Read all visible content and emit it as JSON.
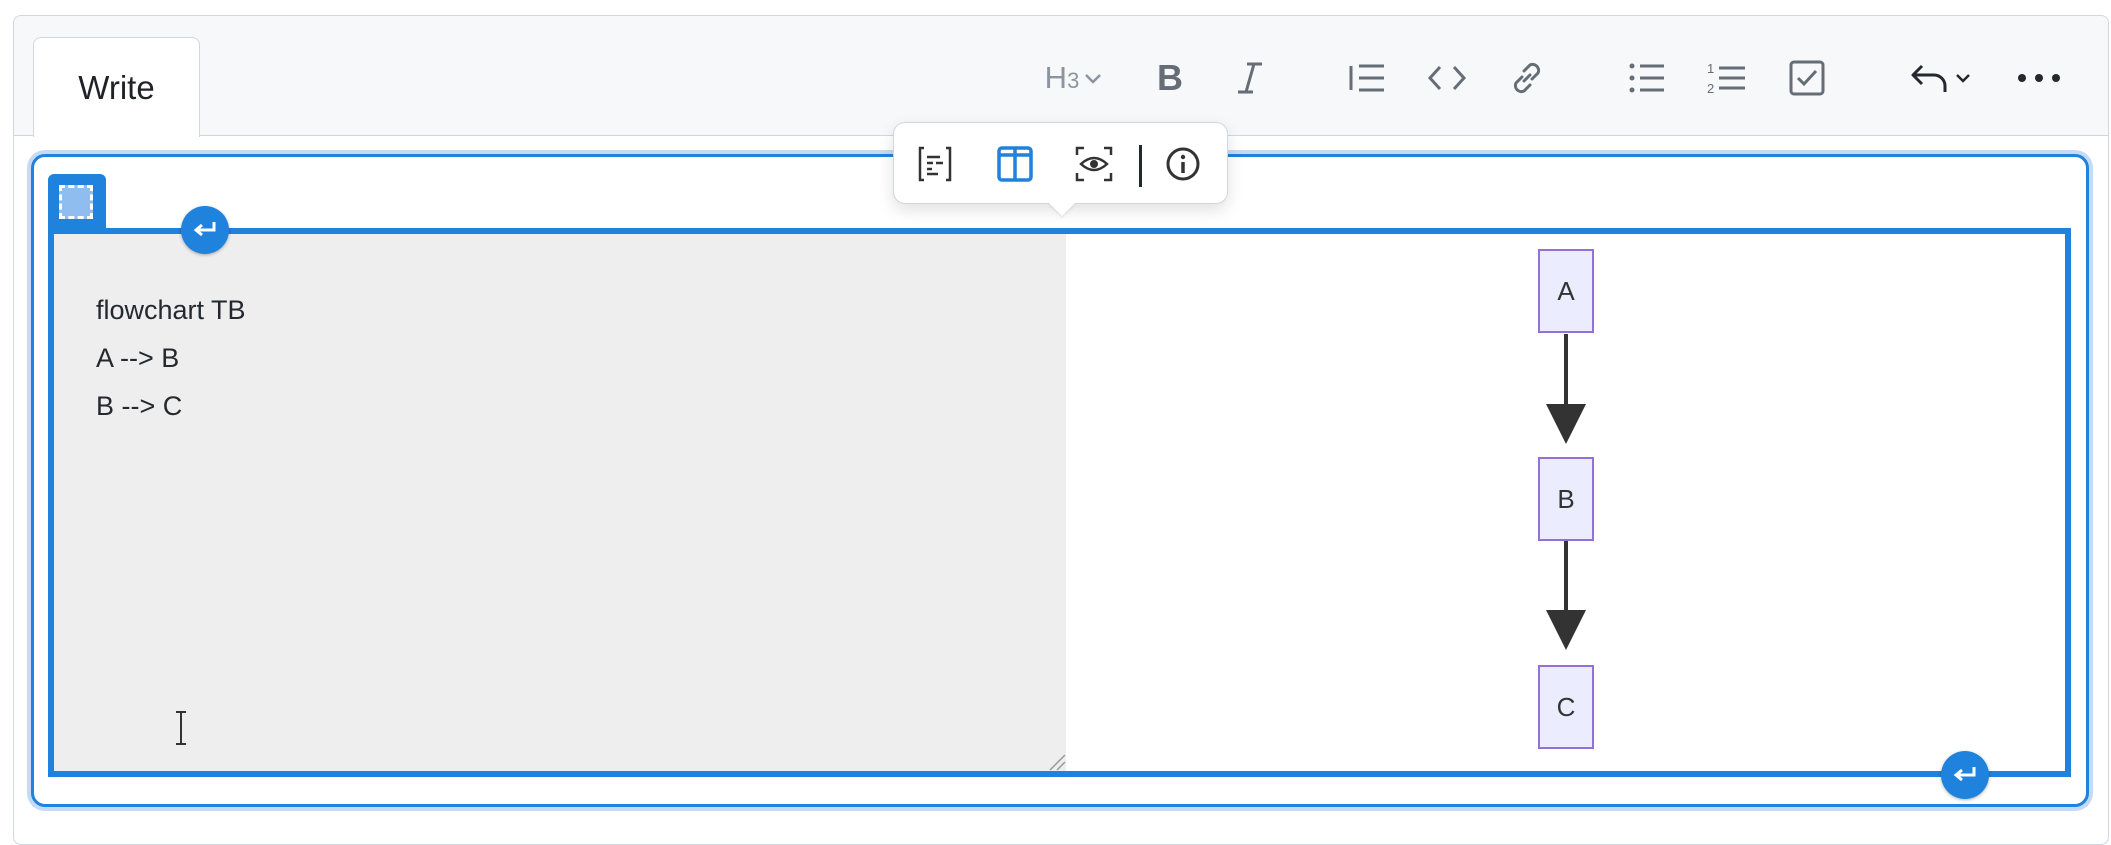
{
  "tabs": {
    "write_label": "Write"
  },
  "toolbar": {
    "heading_label": "H3",
    "buttons": [
      "heading-icon",
      "bold-icon",
      "italic-icon",
      "quote-icon",
      "code-icon",
      "link-icon",
      "bullet-list-icon",
      "numbered-list-icon",
      "task-list-icon",
      "undo-icon",
      "more-icon"
    ]
  },
  "popover": {
    "buttons": [
      "code-only-view-icon",
      "split-view-icon",
      "preview-only-view-icon",
      "info-icon"
    ],
    "active": "split-view-icon"
  },
  "mermaid": {
    "code_lines": [
      "flowchart TB",
      "A --> B",
      "B --> C"
    ],
    "nodes": [
      {
        "id": "A",
        "label": "A"
      },
      {
        "id": "B",
        "label": "B"
      },
      {
        "id": "C",
        "label": "C"
      }
    ],
    "edges": [
      {
        "from": "A",
        "to": "B"
      },
      {
        "from": "B",
        "to": "C"
      }
    ]
  },
  "colors": {
    "accent": "#1f82dd",
    "node_fill": "#ececff",
    "node_stroke": "#9370db",
    "code_pane_bg": "#eeeeee"
  }
}
